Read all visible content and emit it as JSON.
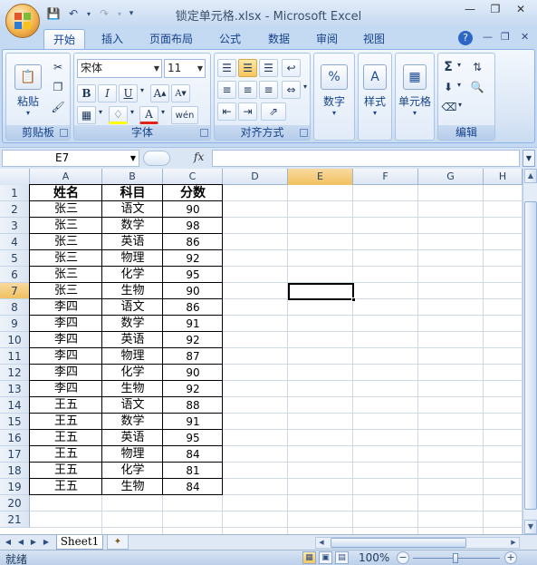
{
  "window": {
    "title": "锁定单元格.xlsx - Microsoft Excel"
  },
  "tabs": [
    "开始",
    "插入",
    "页面布局",
    "公式",
    "数据",
    "审阅",
    "视图"
  ],
  "active_tab": "开始",
  "ribbon": {
    "clipboard": {
      "paste_label": "粘贴",
      "group_label": "剪贴板"
    },
    "font": {
      "font_name": "宋体",
      "font_size": "11",
      "group_label": "字体"
    },
    "alignment": {
      "group_label": "对齐方式"
    },
    "number": {
      "button_label": "数字",
      "icon_text": "%"
    },
    "styles": {
      "button_label": "样式"
    },
    "cells": {
      "button_label": "单元格"
    },
    "editing": {
      "group_label": "编辑"
    }
  },
  "formula_bar": {
    "name_box": "E7",
    "fx": "fx",
    "formula": ""
  },
  "grid": {
    "columns": [
      "A",
      "B",
      "C",
      "D",
      "E",
      "F",
      "G",
      "H"
    ],
    "selected_column": "E",
    "rows": [
      "1",
      "2",
      "3",
      "4",
      "5",
      "6",
      "7",
      "8",
      "9",
      "10",
      "11",
      "12",
      "13",
      "14",
      "15",
      "16",
      "17",
      "18",
      "19",
      "20",
      "21"
    ],
    "selected_row": "7",
    "headers": [
      "姓名",
      "科目",
      "分数"
    ],
    "data": [
      [
        "张三",
        "语文",
        "90"
      ],
      [
        "张三",
        "数学",
        "98"
      ],
      [
        "张三",
        "英语",
        "86"
      ],
      [
        "张三",
        "物理",
        "92"
      ],
      [
        "张三",
        "化学",
        "95"
      ],
      [
        "张三",
        "生物",
        "90"
      ],
      [
        "李四",
        "语文",
        "86"
      ],
      [
        "李四",
        "数学",
        "91"
      ],
      [
        "李四",
        "英语",
        "92"
      ],
      [
        "李四",
        "物理",
        "87"
      ],
      [
        "李四",
        "化学",
        "90"
      ],
      [
        "李四",
        "生物",
        "92"
      ],
      [
        "王五",
        "语文",
        "88"
      ],
      [
        "王五",
        "数学",
        "91"
      ],
      [
        "王五",
        "英语",
        "95"
      ],
      [
        "王五",
        "物理",
        "84"
      ],
      [
        "王五",
        "化学",
        "81"
      ],
      [
        "王五",
        "生物",
        "84"
      ]
    ]
  },
  "sheets": [
    "Sheet1"
  ],
  "status": {
    "ready": "就绪",
    "zoom": "100%"
  },
  "colors": {
    "accent": "#f1c15f",
    "ribbon": "#dbe7f6",
    "grid_line": "#d0d7e5"
  }
}
